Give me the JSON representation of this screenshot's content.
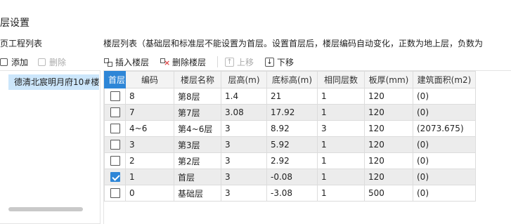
{
  "dialog": {
    "title": "层设置"
  },
  "left": {
    "header": "页工程列表",
    "add_label": "添加",
    "delete_label": "删除",
    "project_item": "德清北宸明月府10#楼"
  },
  "right": {
    "header": "楼层列表（基础层和标准层不能设置为首层。设置首层后，楼层编码自动变化，正数为地上层，负数为",
    "toolbar": {
      "insert": "插入楼层",
      "delete": "删除楼层",
      "up": "上移",
      "down": "下移"
    },
    "columns": [
      "首层",
      "编码",
      "楼层名称",
      "层高(m)",
      "底标高(m)",
      "相同层数",
      "板厚(mm)",
      "建筑面积(m2)"
    ],
    "rows": [
      {
        "first": false,
        "code": "8",
        "name": "第8层",
        "height": "1.4",
        "bottom": "21",
        "same": "1",
        "slab": "120",
        "area": "(0)"
      },
      {
        "first": false,
        "code": "7",
        "name": "第7层",
        "height": "3.08",
        "bottom": "17.92",
        "same": "1",
        "slab": "120",
        "area": "(0)"
      },
      {
        "first": false,
        "code": "4~6",
        "name": "第4~6层",
        "height": "3",
        "bottom": "8.92",
        "same": "3",
        "slab": "120",
        "area": "(2073.675)"
      },
      {
        "first": false,
        "code": "3",
        "name": "第3层",
        "height": "3",
        "bottom": "5.92",
        "same": "1",
        "slab": "120",
        "area": "(0)"
      },
      {
        "first": false,
        "code": "2",
        "name": "第2层",
        "height": "3",
        "bottom": "2.92",
        "same": "1",
        "slab": "120",
        "area": "(0)"
      },
      {
        "first": true,
        "code": "1",
        "name": "首层",
        "height": "3",
        "bottom": "-0.08",
        "same": "1",
        "slab": "120",
        "area": "(0)"
      },
      {
        "first": false,
        "code": "0",
        "name": "基础层",
        "height": "3",
        "bottom": "-3.08",
        "same": "1",
        "slab": "500",
        "area": "(0)"
      }
    ]
  },
  "icons": {
    "insert": "insert-floor-icon",
    "delete": "delete-floor-icon",
    "up": "arrow-up-icon",
    "down": "arrow-down-icon"
  },
  "colors": {
    "accent": "#2e86d7",
    "selection": "#cce6fb",
    "alt_row": "#ececec"
  }
}
